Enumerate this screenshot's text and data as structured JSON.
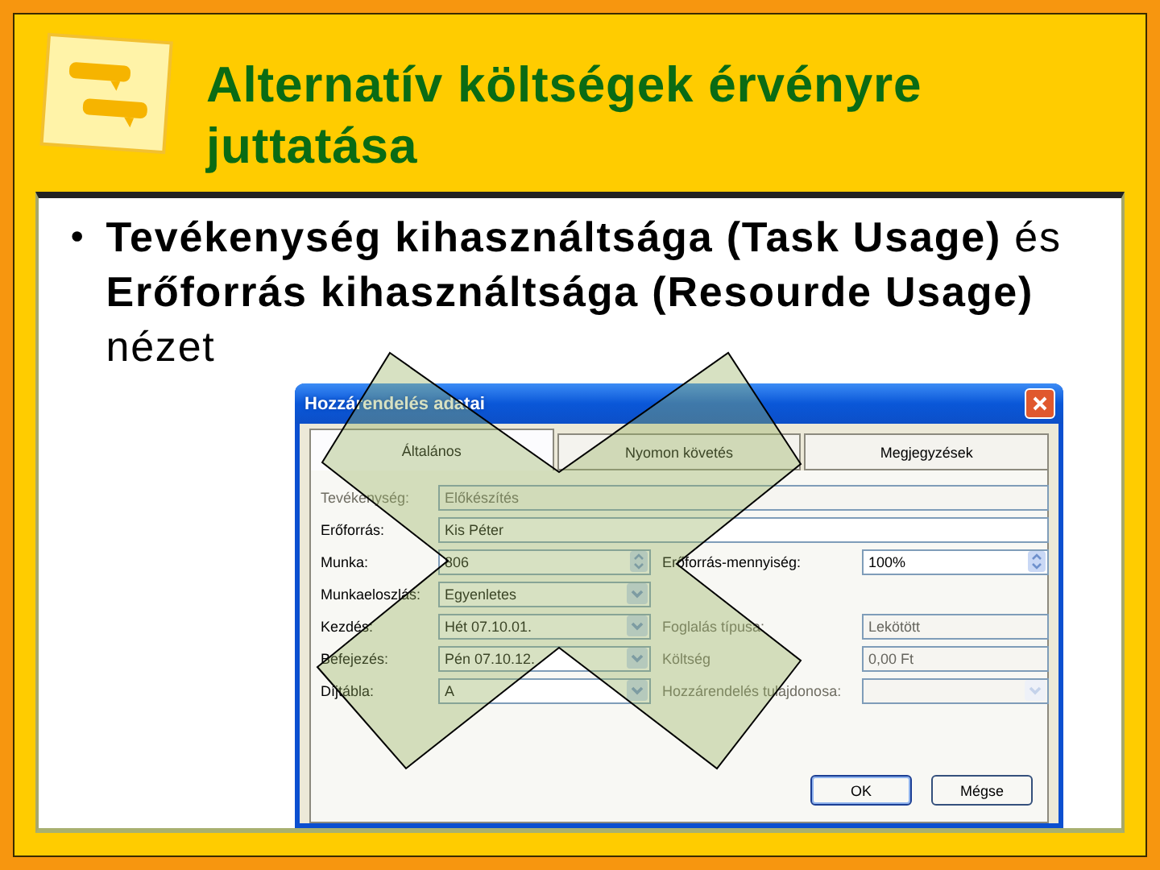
{
  "slide": {
    "title": "Alternatív költségek érvényre juttatása"
  },
  "bullet_marker": "•",
  "bullet": "**Tevékenység kihasználtsága (Task Usage)** és **Erőforrás kihasználtsága (Resourde Usage)** nézet",
  "dialog": {
    "title": "Hozzárendelés adatai",
    "tabs": [
      {
        "label": "Általános",
        "selected": true
      },
      {
        "label": "Nyomon követés",
        "selected": false
      },
      {
        "label": "Megjegyzések",
        "selected": false
      }
    ],
    "rows": [
      {
        "kind": "wide",
        "left": {
          "label": "Tevékenység:",
          "value": "Előkészítés",
          "kind": "text",
          "disabled": true
        }
      },
      {
        "kind": "wide",
        "left": {
          "label": "Erőforrás:",
          "value": "Kis Péter",
          "kind": "text",
          "disabled": false
        }
      },
      {
        "kind": "split",
        "left": {
          "label": "Munka:",
          "value": "806",
          "kind": "spin",
          "disabled": false
        },
        "right": {
          "label": "Erőforrás-mennyiség:",
          "value": "100%",
          "kind": "spin",
          "disabled": false
        }
      },
      {
        "kind": "split",
        "left": {
          "label": "Munkaeloszlás:",
          "value": "Egyenletes",
          "kind": "select",
          "disabled": false
        }
      },
      {
        "kind": "split",
        "left": {
          "label": "Kezdés:",
          "value": "Hét 07.10.01.",
          "kind": "select",
          "disabled": false
        },
        "right": {
          "label": "Foglalás típusa:",
          "value": "Lekötött",
          "kind": "text",
          "disabled": true
        }
      },
      {
        "kind": "split",
        "left": {
          "label": "Befejezés:",
          "value": "Pén 07.10.12.",
          "kind": "select",
          "disabled": false
        },
        "right": {
          "label": "Költség",
          "value": "0,00 Ft",
          "kind": "text",
          "disabled": true
        }
      },
      {
        "kind": "split",
        "left": {
          "label": "Díjtábla:",
          "value": "A",
          "kind": "select",
          "disabled": false
        },
        "right": {
          "label": "Hozzárendelés tulajdonosa:",
          "kind": "select",
          "disabled": true
        }
      }
    ],
    "buttons": [
      {
        "label": "OK",
        "default": true
      },
      {
        "label": "Mégse",
        "default": false
      }
    ]
  }
}
